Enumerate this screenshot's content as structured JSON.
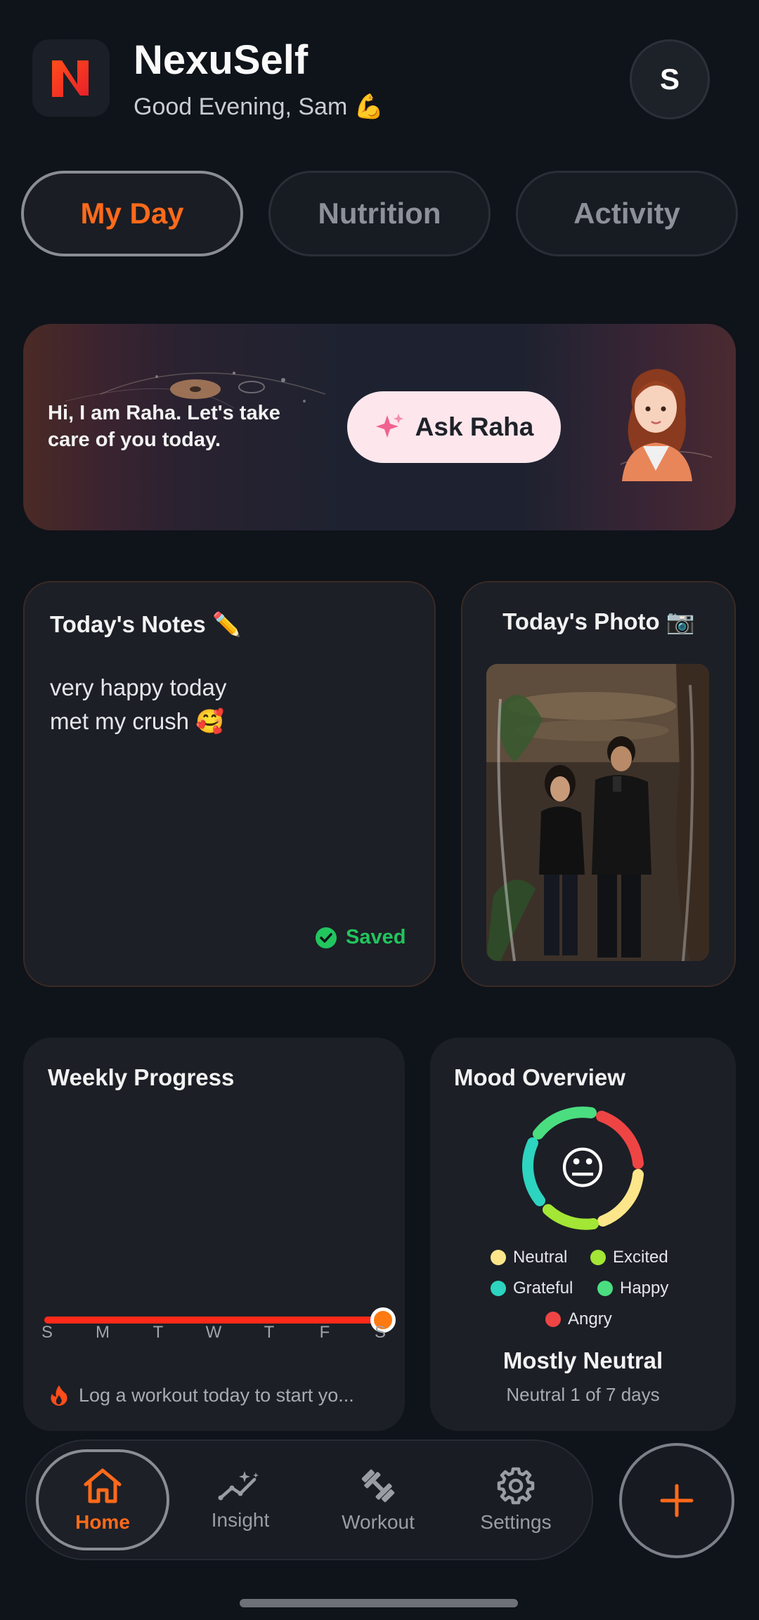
{
  "header": {
    "app_title": "NexuSelf",
    "greeting": "Good Evening, Sam 💪",
    "avatar_initial": "S"
  },
  "tabs": [
    {
      "label": "My Day",
      "active": true
    },
    {
      "label": "Nutrition",
      "active": false
    },
    {
      "label": "Activity",
      "active": false
    }
  ],
  "banner": {
    "text": "Hi, I am Raha. Let's take care of you today.",
    "button_label": "Ask Raha"
  },
  "notes": {
    "title": "Today's Notes ✏️",
    "lines": [
      "very happy today",
      "met my crush 🥰"
    ],
    "saved_label": "Saved"
  },
  "photo": {
    "title": "Today's Photo 📷"
  },
  "weekly_progress": {
    "title": "Weekly Progress",
    "days": [
      "S",
      "M",
      "T",
      "W",
      "T",
      "F",
      "S"
    ],
    "progress": 1.0,
    "hint": "Log a workout today to start yo..."
  },
  "mood": {
    "title": "Mood Overview",
    "face": "😐",
    "legend": [
      {
        "label": "Neutral",
        "color": "#fde68a"
      },
      {
        "label": "Excited",
        "color": "#a3e635"
      },
      {
        "label": "Grateful",
        "color": "#2dd4bf"
      },
      {
        "label": "Happy",
        "color": "#4ade80"
      },
      {
        "label": "Angry",
        "color": "#ef4444"
      }
    ],
    "summary": "Mostly Neutral",
    "detail": "Neutral 1 of 7 days"
  },
  "nav": [
    {
      "label": "Home",
      "icon": "home-icon",
      "active": true
    },
    {
      "label": "Insight",
      "icon": "insight-icon",
      "active": false
    },
    {
      "label": "Workout",
      "icon": "dumbbell-icon",
      "active": false
    },
    {
      "label": "Settings",
      "icon": "gear-icon",
      "active": false
    }
  ],
  "colors": {
    "accent": "#ff6a1a",
    "background": "#0f131a",
    "card": "#1c1f26",
    "success": "#22c55e"
  }
}
